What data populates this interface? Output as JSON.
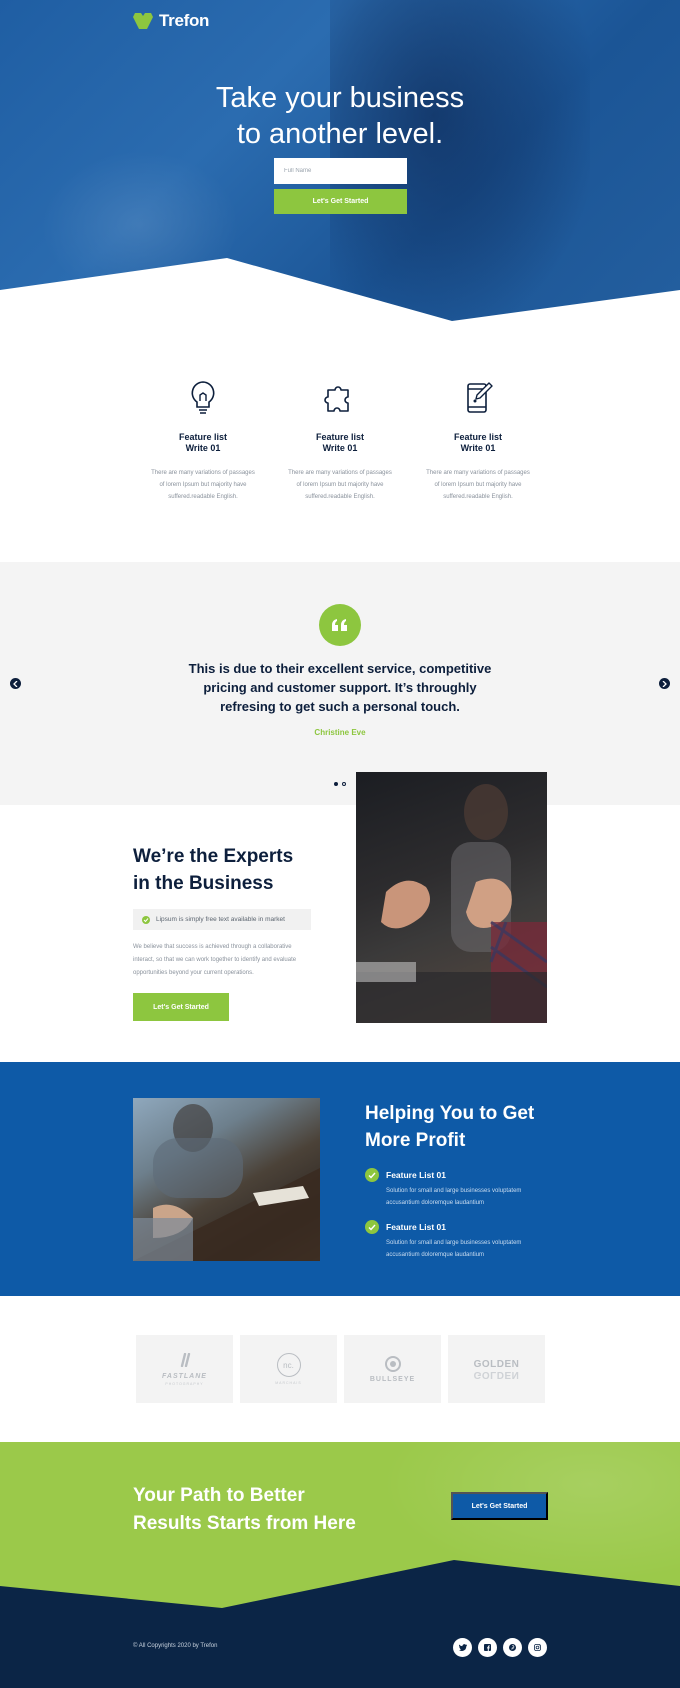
{
  "colors": {
    "brand_blue": "#0e5aa7",
    "accent_green": "#8dc63f",
    "navy": "#0d1f3c"
  },
  "header": {
    "logo_text": "Trefon"
  },
  "hero": {
    "title_line1": "Take your business",
    "title_line2": "to another level.",
    "name_placeholder": "Full Name",
    "cta_label": "Let's Get Started"
  },
  "features": [
    {
      "icon": "lightbulb-icon",
      "title_line1": "Feature list",
      "title_line2": "Write 01",
      "text_line1": "There are many variations of passages",
      "text_line2": "of lorem Ipsum but majority have",
      "text_line3": "suffered.readable English."
    },
    {
      "icon": "puzzle-icon",
      "title_line1": "Feature list",
      "title_line2": "Write 01",
      "text_line1": "There are many variations of passages",
      "text_line2": "of lorem Ipsum but majority have",
      "text_line3": "suffered.readable English."
    },
    {
      "icon": "phone-edit-icon",
      "title_line1": "Feature list",
      "title_line2": "Write 01",
      "text_line1": "There are many variations of passages",
      "text_line2": "of lorem Ipsum but majority have",
      "text_line3": "suffered.readable English."
    }
  ],
  "testimonial": {
    "quote_line1": "This is due to their excellent service, competitive",
    "quote_line2": "pricing and customer support. It’s throughly",
    "quote_line3": "refresing to get such a personal touch.",
    "author": "Christine Eve",
    "active_slide": 1,
    "slide_count": 2
  },
  "experts": {
    "title_line1": "We’re the Experts",
    "title_line2": "in the Business",
    "check_text": "Lipsum is simply free text available in market",
    "text_line1": "We believe that success is achieved through a collaborative",
    "text_line2": "interact, so that we can work together to identify and evaluate",
    "text_line3": "opportunities beyond your current operations.",
    "cta_label": "Let's Get Started"
  },
  "profit": {
    "title_line1": "Helping You to Get",
    "title_line2": "More Profit",
    "items": [
      {
        "title": "Feature List 01",
        "text_line1": "Solution for small and large businesses voluptatem",
        "text_line2": "accusantium doloremque laudantium"
      },
      {
        "title": "Feature List 01",
        "text_line1": "Solution for small and large businesses voluptatem",
        "text_line2": "accusantium doloremque laudantium"
      }
    ]
  },
  "brands": [
    {
      "name": "FASTLANE",
      "sub": "PHOTOGRAPHY"
    },
    {
      "name": "nc.",
      "sub": "MARCHAIS"
    },
    {
      "name": "BULLSEYE",
      "sub": ""
    },
    {
      "name": "GOLDEN",
      "sub": "GOLDEN"
    }
  ],
  "cta": {
    "title_line1": "Your Path to Better",
    "title_line2": "Results Starts from Here",
    "button_label": "Let's Get Started"
  },
  "footer": {
    "copyright": "© All Copyrights 2020 by Trefon",
    "socials": [
      "twitter-icon",
      "facebook-icon",
      "pinterest-icon",
      "instagram-icon"
    ]
  }
}
